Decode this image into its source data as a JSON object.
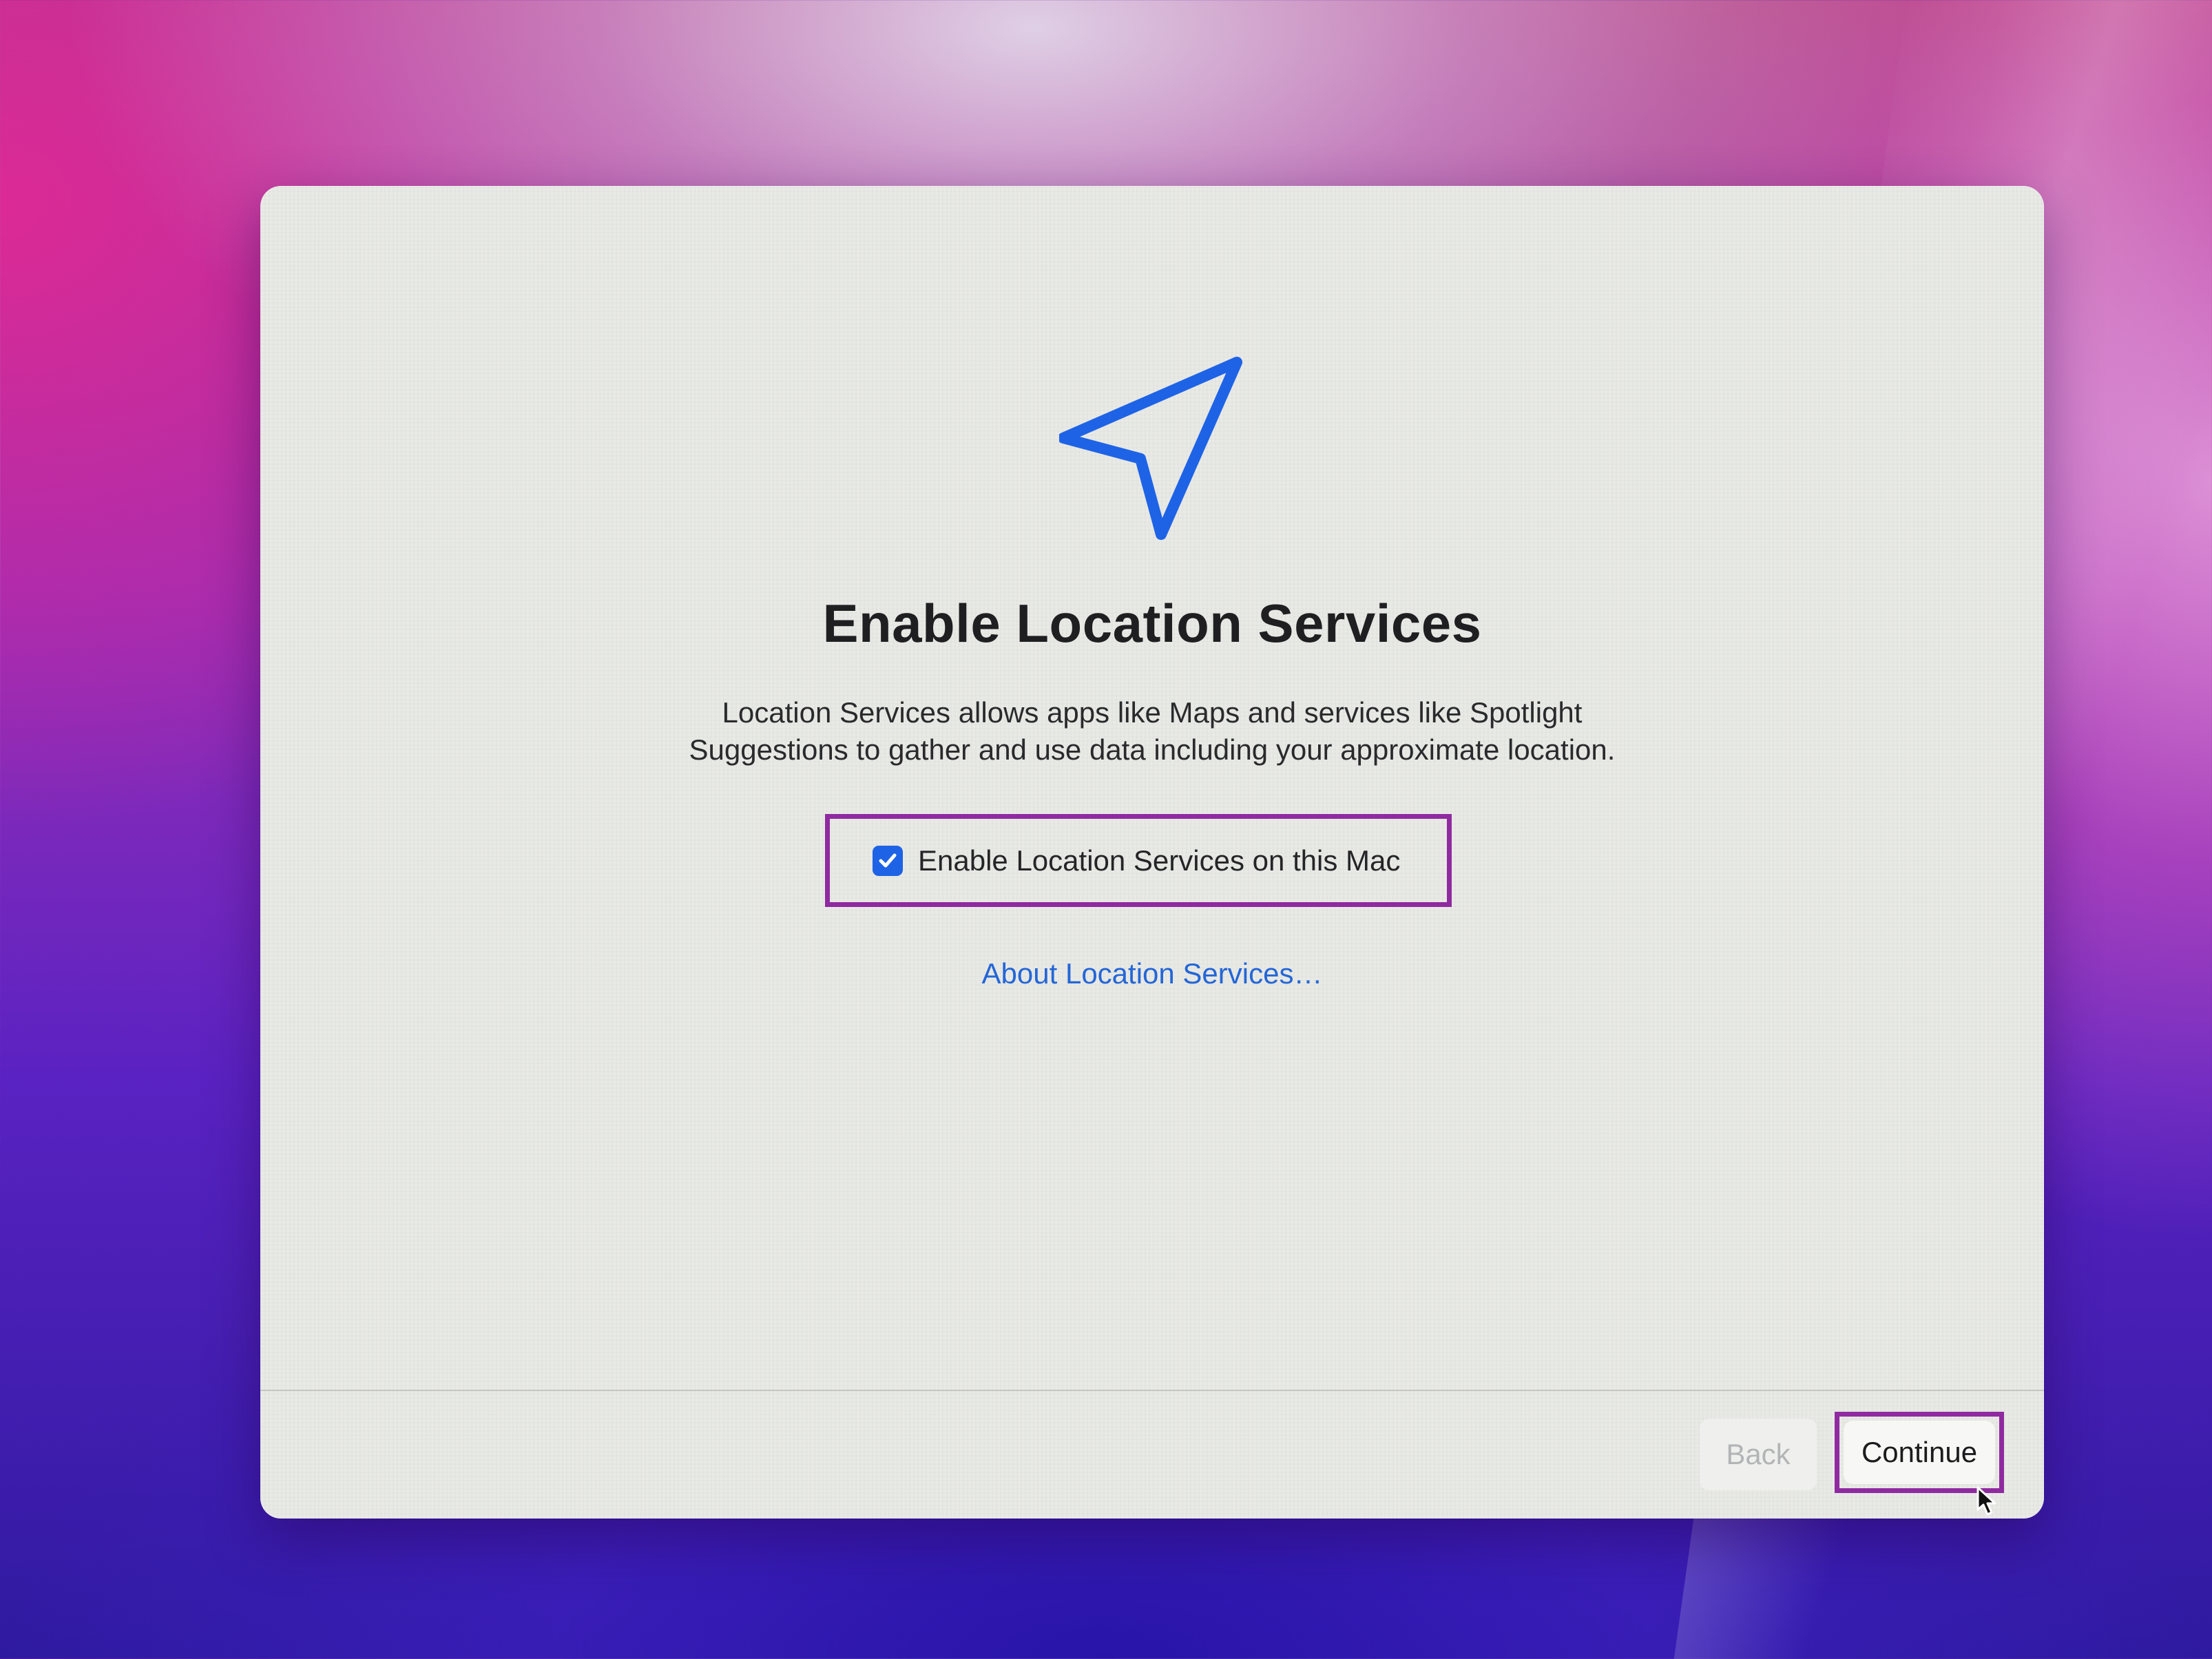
{
  "dialog": {
    "icon": "location-arrow-icon",
    "title": "Enable Location Services",
    "description_line1": "Location Services allows apps like Maps and services like Spotlight",
    "description_line2": "Suggestions to gather and use data including your approximate location.",
    "checkbox": {
      "label": "Enable Location Services on this Mac",
      "checked": true
    },
    "about_link": "About Location Services…"
  },
  "footer": {
    "back_label": "Back",
    "continue_label": "Continue"
  },
  "colors": {
    "accent": "#1e63e6",
    "link": "#2466d6",
    "highlight_box": "#8f2aa0"
  }
}
